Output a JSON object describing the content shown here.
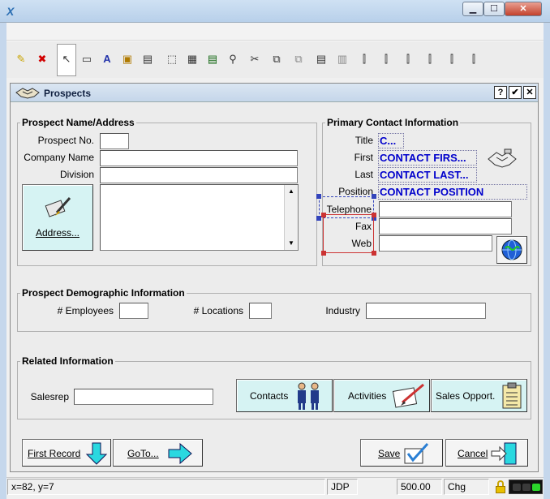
{
  "window": {
    "app_icon": "X",
    "min_label": "▁",
    "max_label": "☐",
    "close_label": "✕"
  },
  "toolbar": {
    "items": [
      "✎",
      "✖",
      "↖",
      "▭",
      "A",
      "▣",
      "▤",
      "⬚",
      "▦",
      "▤",
      "⚲",
      "✂",
      "⧉",
      "⧉",
      "▤",
      "▥",
      "⫿",
      "⫿",
      "⫿",
      "⫿",
      "⫿",
      "⫿"
    ]
  },
  "form": {
    "title": "Prospects",
    "help_label": "?",
    "ok_label": "✔",
    "close_label": "✕"
  },
  "prospect": {
    "section_label": "Prospect Name/Address",
    "prospect_no_label": "Prospect No.",
    "prospect_no_value": "",
    "company_label": "Company Name",
    "company_value": "",
    "division_label": "Division",
    "division_value": "",
    "address_button": "Address...",
    "address_value": ""
  },
  "contact": {
    "section_label": "Primary Contact Information",
    "title_label": "Title",
    "title_value": "C...",
    "first_label": "First",
    "first_value": "CONTACT FIRS...",
    "last_label": "Last",
    "last_value": "CONTACT LAST...",
    "position_label": "Position",
    "position_value": "CONTACT POSITION",
    "telephone_label": "Telephone",
    "fax_label": "Fax",
    "web_label": "Web"
  },
  "demographic": {
    "section_label": "Prospect Demographic Information",
    "employees_label": "# Employees",
    "locations_label": "# Locations",
    "industry_label": "Industry"
  },
  "related": {
    "section_label": "Related Information",
    "salesrep_label": "Salesrep",
    "contacts_button": "Contacts",
    "activities_button": "Activities",
    "sales_button": "Sales Opport."
  },
  "footer": {
    "first_record_button": "First Record",
    "goto_button": "GoTo...",
    "save_button": "Save",
    "cancel_button": "Cancel"
  },
  "status": {
    "coords": "x=82, y=7",
    "user": "JDP",
    "amount": "500.00",
    "mode": "Chg"
  }
}
